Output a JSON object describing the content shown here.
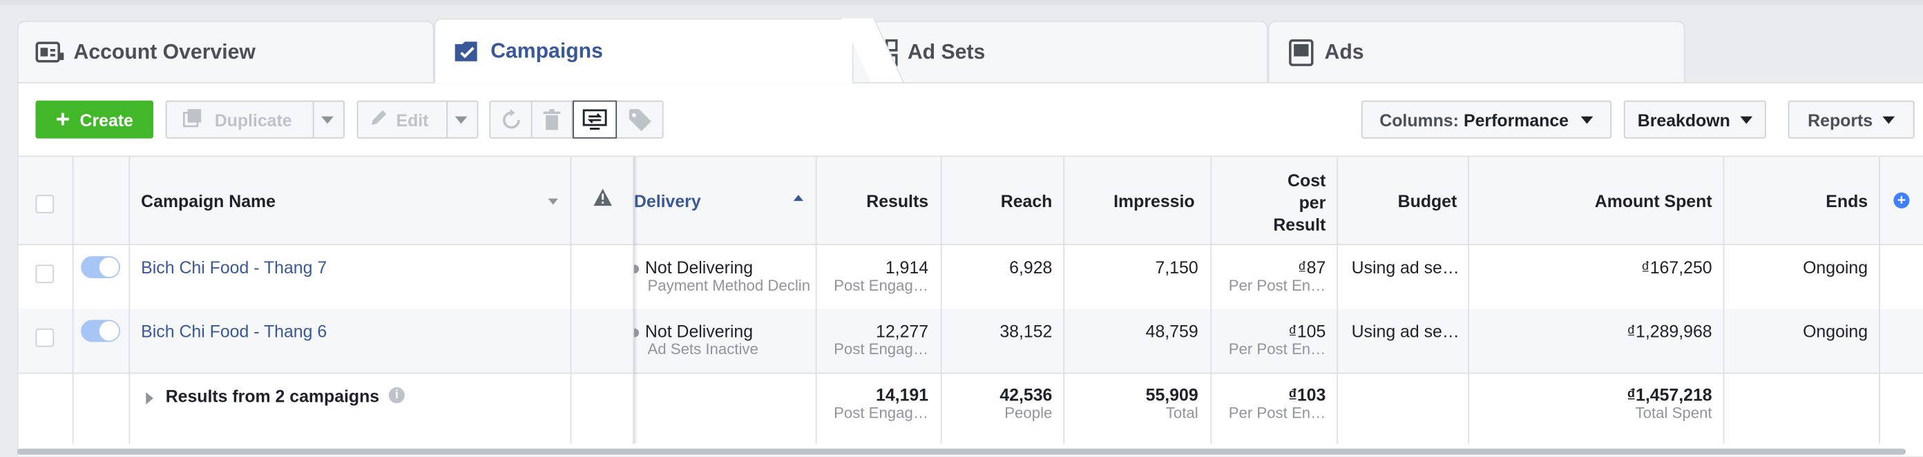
{
  "tabs": [
    {
      "label": "Account Overview",
      "icon": "account-overview-icon"
    },
    {
      "label": "Campaigns",
      "icon": "campaigns-checkbox-icon"
    },
    {
      "label": "Ad Sets",
      "icon": "ad-sets-grid-icon"
    },
    {
      "label": "Ads",
      "icon": "ads-icon"
    }
  ],
  "toolbar": {
    "create": "Create",
    "duplicate": "Duplicate",
    "edit": "Edit",
    "columns_prefix": "Columns:",
    "columns_value": "Performance",
    "breakdown": "Breakdown",
    "reports": "Reports"
  },
  "headers": {
    "campaign_name": "Campaign Name",
    "delivery": "Delivery",
    "results": "Results",
    "reach": "Reach",
    "impressions": "Impressio",
    "cost_l1": "Cost",
    "cost_l2": "per",
    "cost_l3": "Result",
    "budget": "Budget",
    "amount_spent": "Amount Spent",
    "ends": "Ends"
  },
  "rows": [
    {
      "name": "Bich Chi Food - Thang 7",
      "delivery": "Not Delivering",
      "delivery_sub": "Payment Method Declin",
      "results": "1,914",
      "results_sub": "Post Engag…",
      "reach": "6,928",
      "impressions": "7,150",
      "cost": "₫87",
      "cost_sub": "Per Post En…",
      "budget": "Using ad se…",
      "spent": "₫167,250",
      "ends": "Ongoing"
    },
    {
      "name": "Bich Chi Food - Thang 6",
      "delivery": "Not Delivering",
      "delivery_sub": "Ad Sets Inactive",
      "results": "12,277",
      "results_sub": "Post Engag…",
      "reach": "38,152",
      "impressions": "48,759",
      "cost": "₫105",
      "cost_sub": "Per Post En…",
      "budget": "Using ad se…",
      "spent": "₫1,289,968",
      "ends": "Ongoing"
    }
  ],
  "totals": {
    "label": "Results from 2 campaigns",
    "results": "14,191",
    "results_sub": "Post Engag…",
    "reach": "42,536",
    "reach_sub": "People",
    "impressions": "55,909",
    "impressions_sub": "Total",
    "cost": "₫103",
    "cost_sub": "Per Post En…",
    "spent": "₫1,457,218",
    "spent_sub": "Total Spent"
  },
  "colors": {
    "accent": "#385898",
    "create": "#42b72a",
    "toggle_on": "#a8c6f5"
  }
}
